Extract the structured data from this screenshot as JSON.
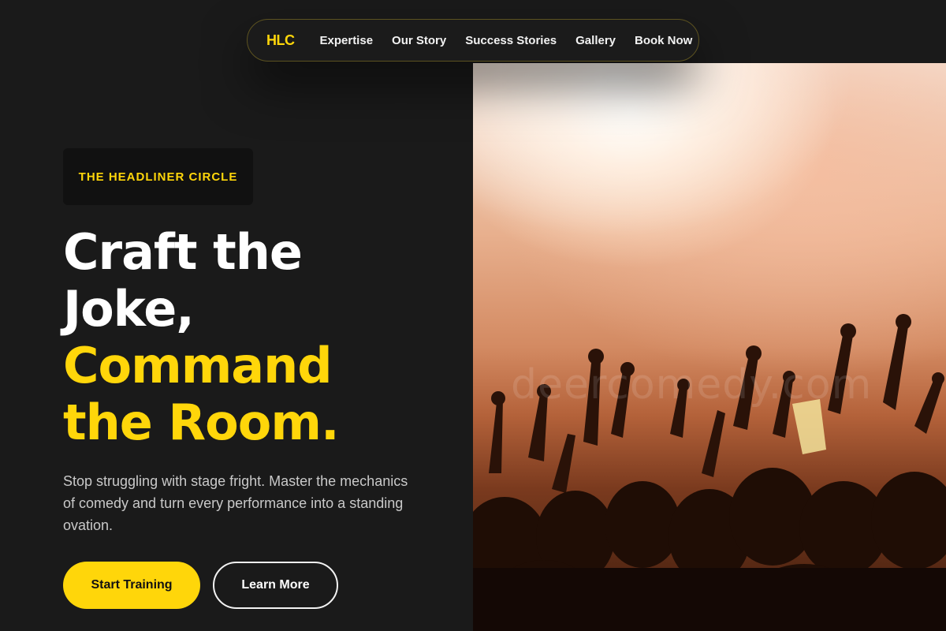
{
  "nav": {
    "logo": "HLC",
    "links": [
      "Expertise",
      "Our Story",
      "Success Stories",
      "Gallery",
      "Book Now"
    ]
  },
  "hero": {
    "badge": "THE HEADLINER CIRCLE",
    "headline_white": [
      "Craft the",
      "Joke,"
    ],
    "headline_yellow": [
      "Command",
      "the Room."
    ],
    "subtext": "Stop struggling with stage fright. Master the mechanics of comedy and turn every performance into a standing ovation.",
    "primary_button": "Start Training",
    "secondary_button": "Learn More"
  },
  "image": {
    "description_icon": "concert-crowd-image",
    "watermark": "deercomedy.com"
  },
  "colors": {
    "accent": "#ffd60a",
    "background": "#1a1a1a",
    "text": "#ffffff"
  }
}
